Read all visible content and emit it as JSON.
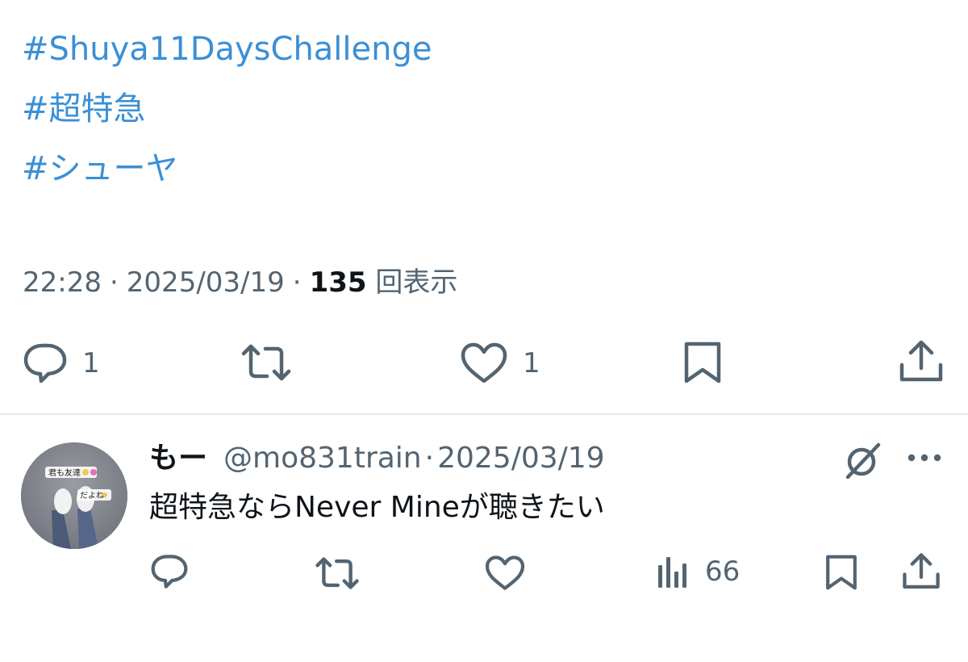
{
  "tweet": {
    "hashtags": [
      "#Shuya11DaysChallenge",
      "#超特急",
      "#シューヤ"
    ],
    "time": "22:28",
    "date": "2025/03/19",
    "separator": "·",
    "views_count": "135",
    "views_label": "回表示",
    "actions": {
      "reply_count": "1",
      "like_count": "1"
    },
    "icons": [
      "reply-icon",
      "retweet-icon",
      "like-icon",
      "bookmark-icon",
      "share-icon"
    ]
  },
  "reply": {
    "display_name": "もー",
    "handle": "@mo831train",
    "separator": "·",
    "date": "2025/03/19",
    "text": "超特急ならNever Mineが聴きたい",
    "views_count": "66",
    "avatar_stickers": [
      "君も友達",
      "だよね"
    ],
    "icons": [
      "grok-icon",
      "more-icon",
      "reply-icon",
      "retweet-icon",
      "like-icon",
      "views-icon",
      "bookmark-icon",
      "share-icon"
    ]
  },
  "colors": {
    "link": "#3b8fd6",
    "secondary_text": "#536471",
    "primary_text": "#0f1419",
    "divider": "#e6e9ec"
  }
}
